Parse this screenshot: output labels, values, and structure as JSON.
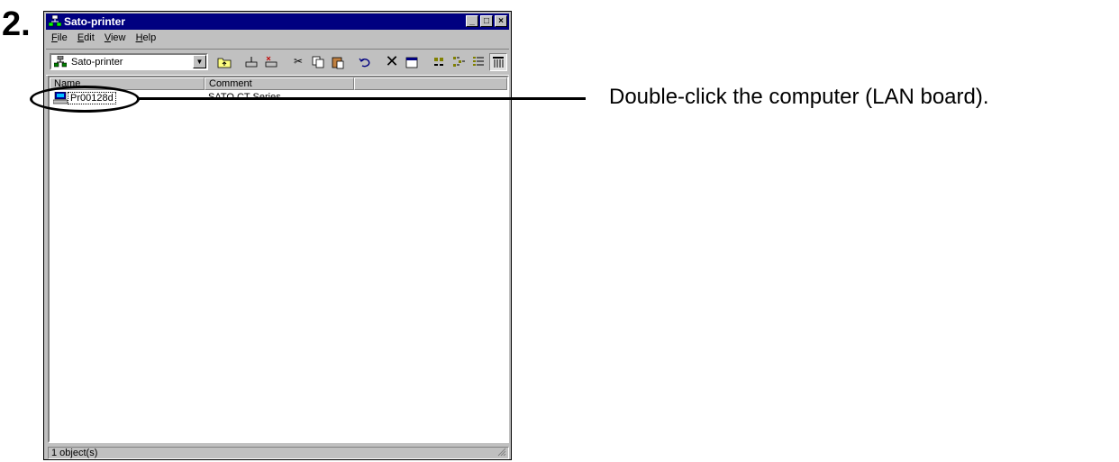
{
  "step_number": "2.",
  "window": {
    "title": "Sato-printer",
    "controls": {
      "minimize": "_",
      "maximize": "□",
      "close": "×"
    }
  },
  "menu": [
    "File",
    "Edit",
    "View",
    "Help"
  ],
  "toolbar": {
    "address_value": "Sato-printer",
    "buttons": [
      "up-folder",
      "map-drive",
      "disconnect-drive",
      "cut",
      "copy",
      "paste",
      "undo",
      "delete",
      "properties",
      "large-icons",
      "small-icons",
      "list",
      "details"
    ]
  },
  "list": {
    "columns": [
      "Name",
      "Comment"
    ],
    "rows": [
      {
        "name": "Pr00128d",
        "comment": "SATO CT Series"
      }
    ]
  },
  "status": {
    "text": "1 object(s)"
  },
  "callout": {
    "text": "Double-click the computer (LAN board)."
  }
}
